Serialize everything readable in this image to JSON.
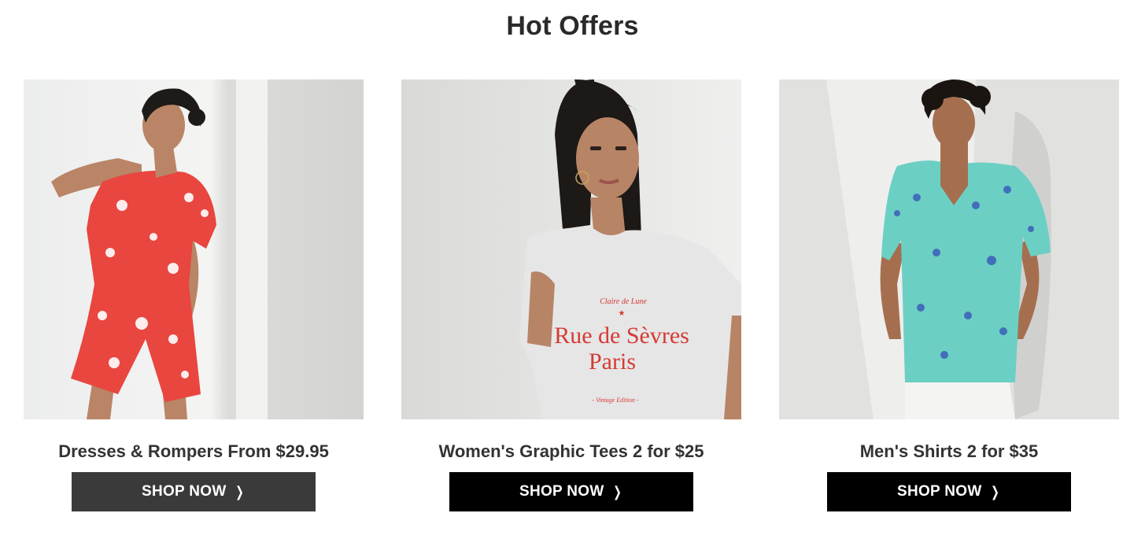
{
  "section": {
    "title": "Hot Offers"
  },
  "offers": [
    {
      "caption": "Dresses & Rompers From $29.95",
      "button_label": "SHOP NOW",
      "button_icon": "chevron-right-icon",
      "button_color": "#3a3a3a"
    },
    {
      "caption": "Women's Graphic Tees 2 for $25",
      "button_label": "SHOP NOW",
      "button_icon": "chevron-right-icon",
      "button_color": "#000000",
      "tee_print": {
        "top_line": "Claire de Lune",
        "main_line_1": "Rue de Sèvres",
        "main_line_2": "Paris",
        "bottom_line": "- Vintage Edition -"
      }
    },
    {
      "caption": "Men's Shirts 2 for $35",
      "button_label": "SHOP NOW",
      "button_icon": "chevron-right-icon",
      "button_color": "#000000"
    }
  ],
  "colors": {
    "romper_red": "#e8463f",
    "tee_gray": "#e6e6e6",
    "print_red": "#d63a33",
    "shirt_teal": "#6ccfc4"
  }
}
